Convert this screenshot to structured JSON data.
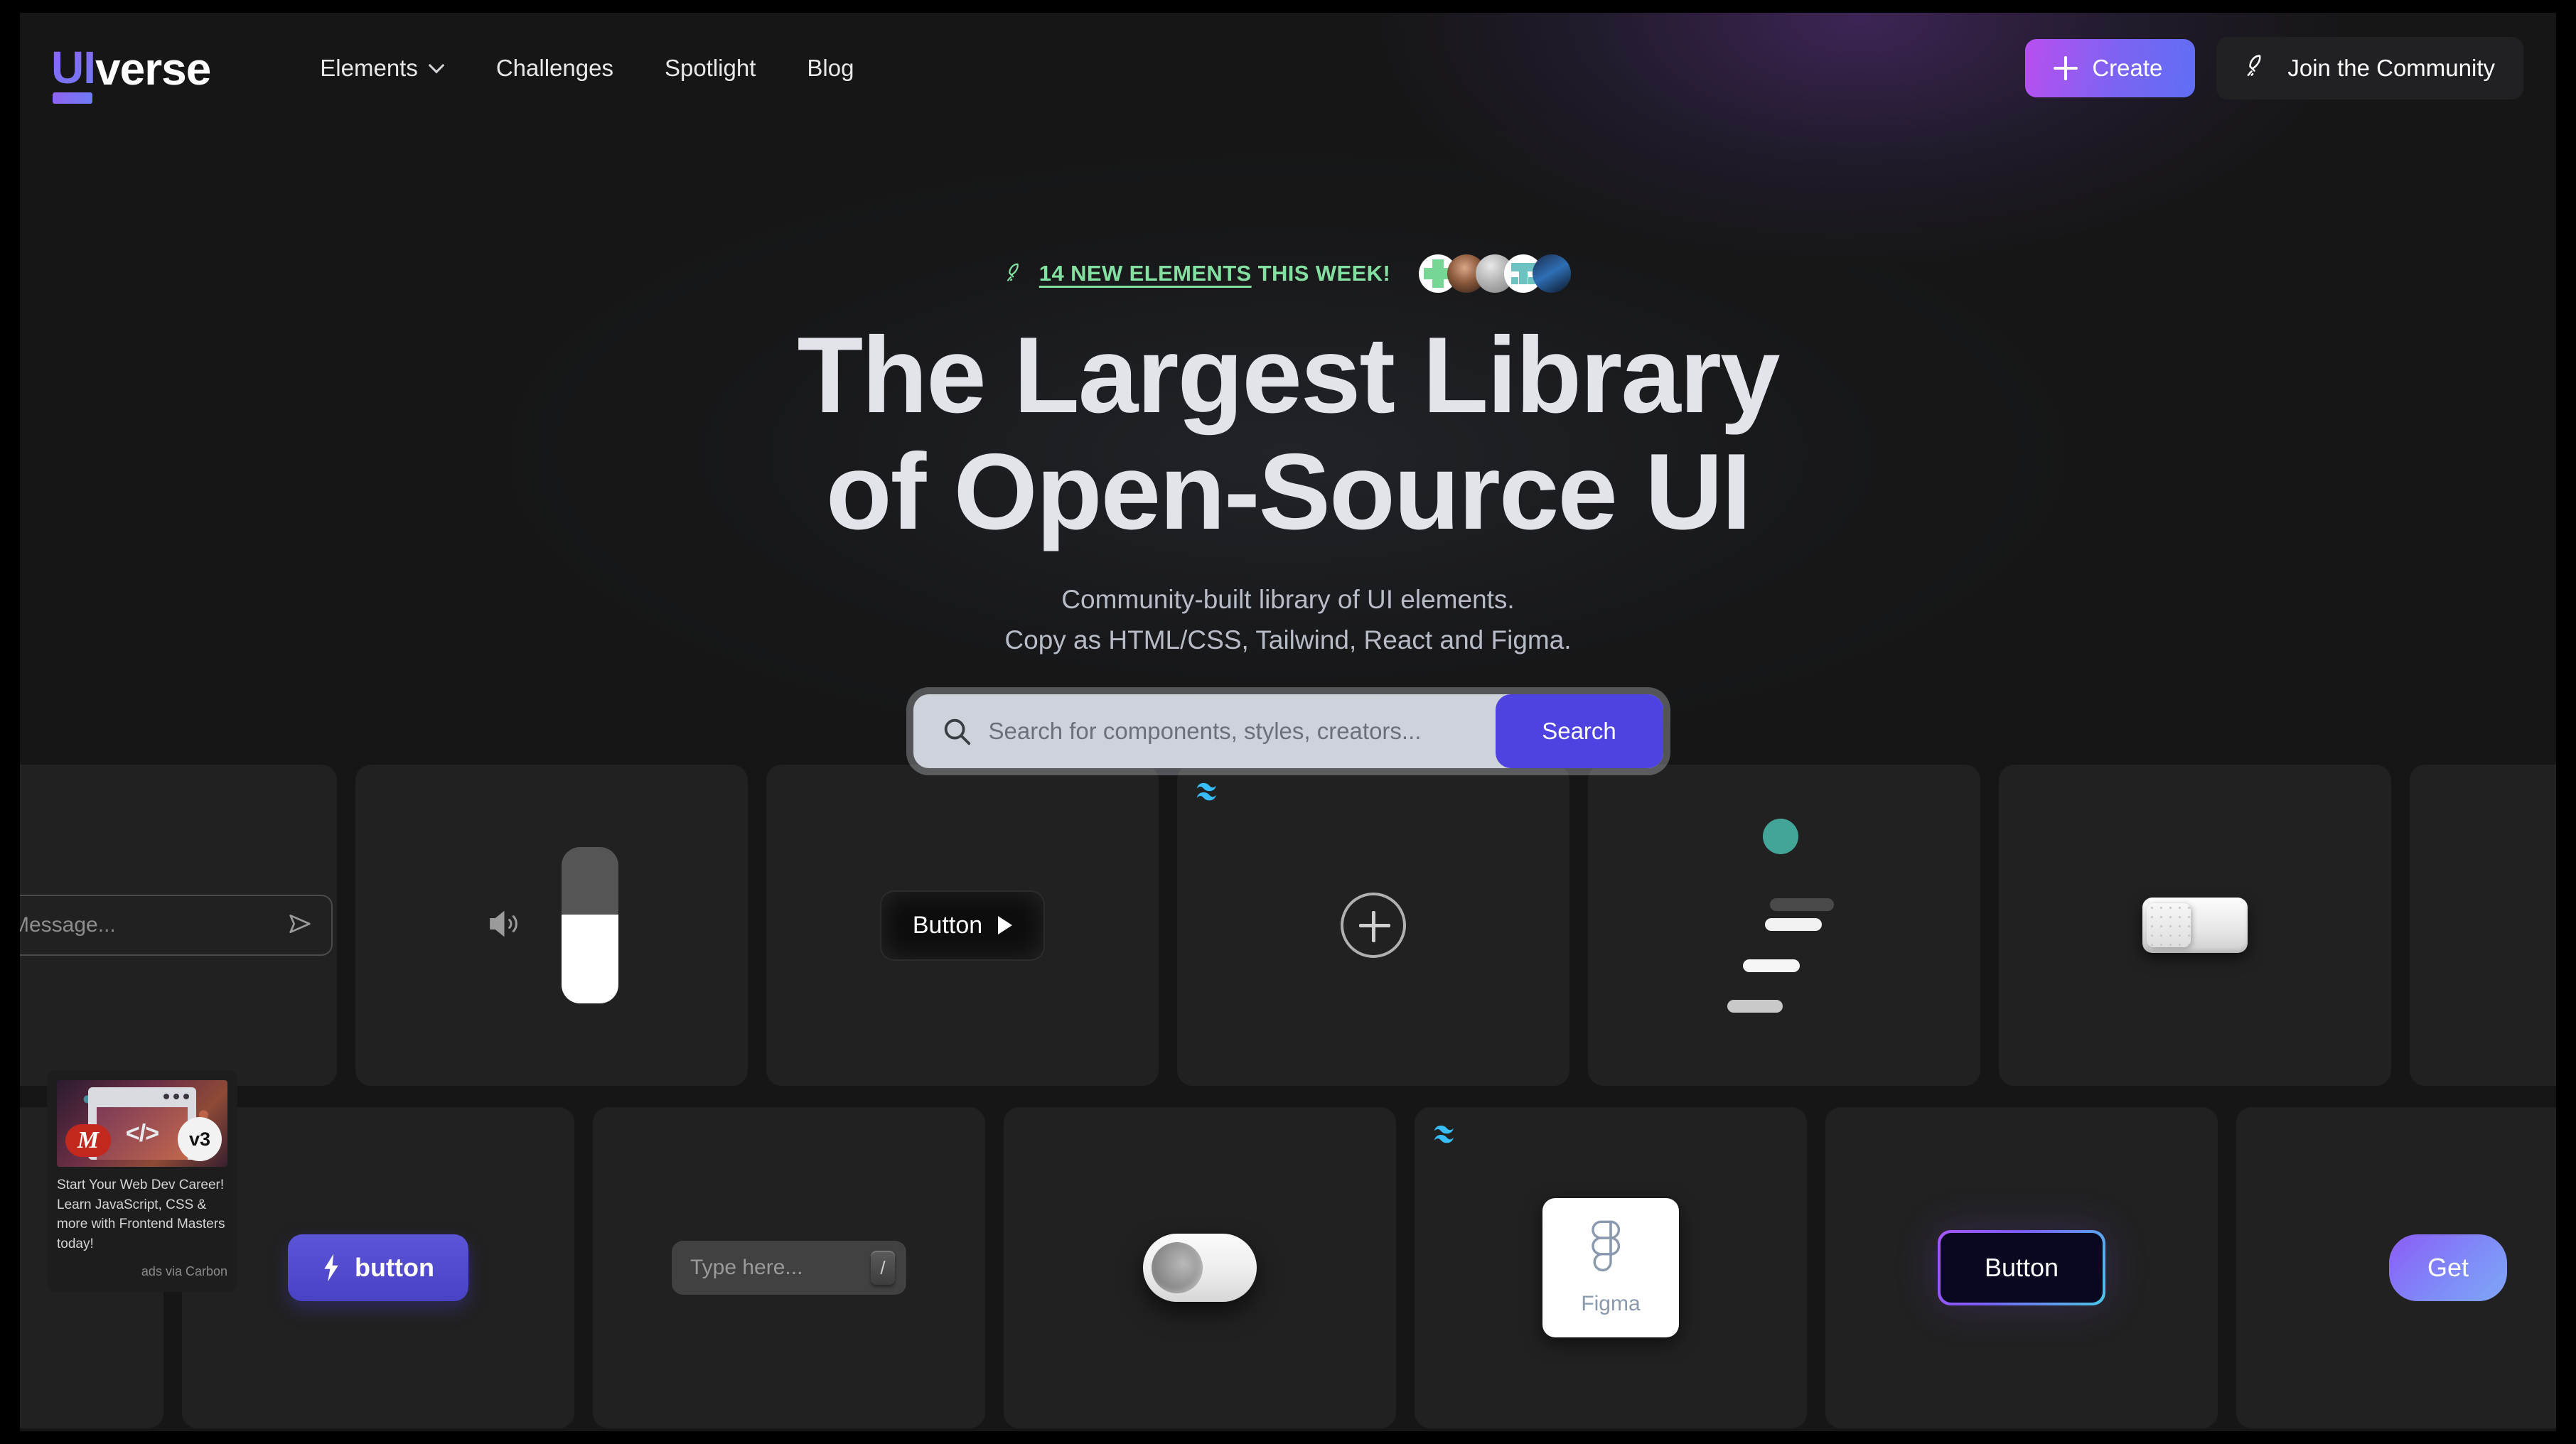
{
  "nav": {
    "logo_ui": "UI",
    "logo_verse": "verse",
    "links": [
      {
        "label": "Elements",
        "has_chevron": true
      },
      {
        "label": "Challenges",
        "has_chevron": false
      },
      {
        "label": "Spotlight",
        "has_chevron": false
      },
      {
        "label": "Blog",
        "has_chevron": false
      }
    ],
    "create_label": "Create",
    "community_label": "Join the Community"
  },
  "hero": {
    "announce_link": "14 NEW ELEMENTS",
    "announce_rest": " THIS WEEK!",
    "headline_line1": "The Largest Library",
    "headline_line2": "of Open-Source UI",
    "subtitle_line1": "Community-built library of UI elements.",
    "subtitle_line2": "Copy as HTML/CSS, Tailwind, React and Figma.",
    "avatar_count": 5
  },
  "search": {
    "placeholder": "Search for components, styles, creators...",
    "value": "",
    "button_label": "Search"
  },
  "cards": {
    "row1": [
      {
        "name": "message-input-card",
        "kind": "message-input",
        "placeholder": "Message...",
        "tailwind_badge": false
      },
      {
        "name": "volume-slider-card",
        "kind": "volume-slider",
        "fill_percent": 57,
        "tailwind_badge": false
      },
      {
        "name": "play-button-card",
        "kind": "play-button",
        "label": "Button",
        "tailwind_badge": false
      },
      {
        "name": "circle-plus-card",
        "kind": "circle-plus",
        "tailwind_badge": true
      },
      {
        "name": "skeleton-loader-card",
        "kind": "skeleton",
        "accent": "#43a597",
        "tailwind_badge": false
      },
      {
        "name": "rocker-switch-card",
        "kind": "rocker-switch",
        "tailwind_badge": false
      }
    ],
    "row2": [
      {
        "name": "lightning-button-card",
        "kind": "lightning-button",
        "label": "button",
        "tailwind_badge": false
      },
      {
        "name": "type-here-input-card",
        "kind": "type-input",
        "placeholder": "Type here...",
        "key_hint": "/",
        "tailwind_badge": false
      },
      {
        "name": "toggle-3d-card",
        "kind": "toggle-3d",
        "tailwind_badge": false
      },
      {
        "name": "figma-card",
        "kind": "figma",
        "label": "Figma",
        "tailwind_badge": true
      },
      {
        "name": "gradient-border-button-card",
        "kind": "gradient-button",
        "label": "Button",
        "tailwind_badge": false
      },
      {
        "name": "get-pill-card",
        "kind": "get-pill",
        "label": "Get",
        "tailwind_badge": false
      }
    ]
  },
  "ad": {
    "image_code": "</>",
    "brand_mark": "M",
    "version_badge": "v3",
    "text": "Start Your Web Dev Career! Learn JavaScript, CSS & more with Frontend Masters today!",
    "attribution": "ads via Carbon"
  },
  "colors": {
    "background": "#161616",
    "card": "#212121",
    "accent_purple": "#7b64f2",
    "accent_blue": "#4e43e0",
    "announce_green": "#84e0a0",
    "headline": "#e2e4e9",
    "tailwind_blue": "#38bdf8"
  }
}
